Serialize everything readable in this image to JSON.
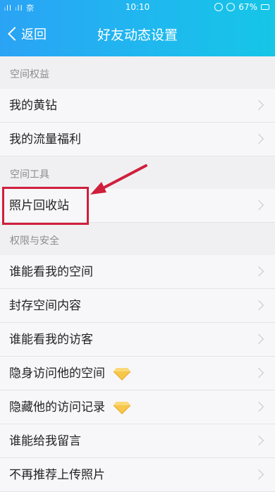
{
  "status_bar": {
    "signal": "ᵢll ᵢll 奈",
    "time": "10:10",
    "battery": "67%"
  },
  "nav": {
    "back_label": "返回",
    "title": "好友动态设置"
  },
  "sections": [
    {
      "label": "空间权益",
      "items": [
        "我的黄钻",
        "我的流量福利"
      ]
    },
    {
      "label": "空间工具",
      "items": [
        "照片回收站"
      ]
    },
    {
      "label": "权限与安全",
      "items": [
        "谁能看我的空间",
        "封存空间内容",
        "谁能看我的访客",
        "隐身访问他的空间",
        "隐藏他的访问记录",
        "谁能给我留言",
        "不再推荐上传照片"
      ]
    }
  ],
  "colors": {
    "header_start": "#2aa3f5",
    "header_end": "#15c6e6",
    "highlight": "#d01f3c",
    "diamond": "#f7c64a"
  }
}
